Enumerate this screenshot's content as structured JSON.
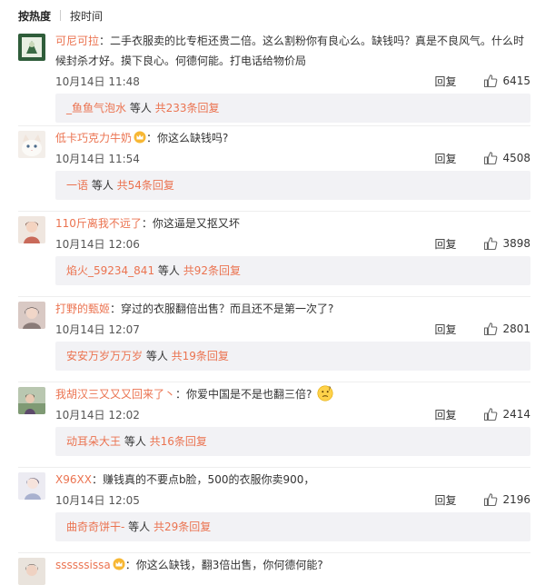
{
  "sort": {
    "hot": "按热度",
    "time": "按时间"
  },
  "reply_label": "回复",
  "comments": [
    {
      "user": "可尼可拉",
      "text_line1": "：二手衣服卖的比专柜还贵二倍。这么割粉你有良心么。缺钱吗？真是不良风气。什么时",
      "text_line2": "候封杀才好。摸下良心。何德何能。打电话给物价局",
      "time": "10月14日 11:48",
      "likes": "6415",
      "sub_user": "_鱼鱼气泡水",
      "sub_mid": " 等人 ",
      "sub_count": "共233条回复"
    },
    {
      "user": "低卡巧克力牛奶",
      "text_line1": "：你这么缺钱吗?",
      "time": "10月14日 11:54",
      "likes": "4508",
      "sub_user": "一语",
      "sub_mid": " 等人 ",
      "sub_count": "共54条回复"
    },
    {
      "user": "110斤离我不远了",
      "text_line1": "：你这逼是又抠又坏",
      "time": "10月14日 12:06",
      "likes": "3898",
      "sub_user": "焰火_59234_841",
      "sub_mid": " 等人 ",
      "sub_count": "共92条回复"
    },
    {
      "user": "打野的甄姬",
      "text_line1": "：穿过的衣服翻倍出售？而且还不是第一次了?",
      "time": "10月14日 12:07",
      "likes": "2801",
      "sub_user": "安安万岁万万岁",
      "sub_mid": " 等人 ",
      "sub_count": "共19条回复"
    },
    {
      "user": "我胡汉三又又又回来了丶",
      "text_line1": "：你爱中国是不是也翻三倍?",
      "time": "10月14日 12:02",
      "likes": "2414",
      "sub_user": "动耳朵大王",
      "sub_mid": " 等人 ",
      "sub_count": "共16条回复"
    },
    {
      "user": "X96XX",
      "text_line1": "：赚钱真的不要点b脸，500的衣服你卖900，",
      "time": "10月14日 12:05",
      "likes": "2196",
      "sub_user": "曲奇奇饼干-",
      "sub_mid": " 等人 ",
      "sub_count": "共29条回复"
    },
    {
      "user": "ssssssissa",
      "text_line1": "：你这么缺钱，翻3倍出售，你何德何能?"
    }
  ],
  "colors": {
    "username": "#eb7350",
    "subbox_bg": "#f2f2f5"
  }
}
